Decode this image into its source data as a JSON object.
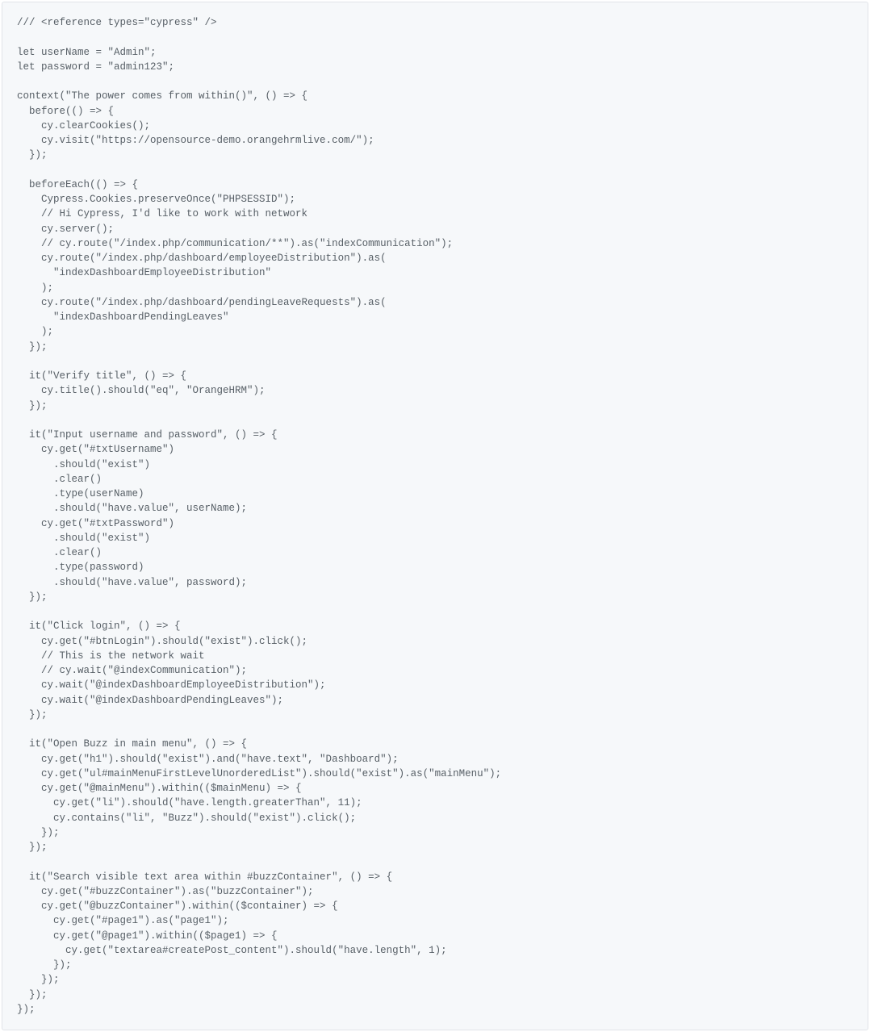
{
  "code": "/// <reference types=\"cypress\" />\n\nlet userName = \"Admin\";\nlet password = \"admin123\";\n\ncontext(\"The power comes from within()\", () => {\n  before(() => {\n    cy.clearCookies();\n    cy.visit(\"https://opensource-demo.orangehrmlive.com/\");\n  });\n\n  beforeEach(() => {\n    Cypress.Cookies.preserveOnce(\"PHPSESSID\");\n    // Hi Cypress, I'd like to work with network\n    cy.server();\n    // cy.route(\"/index.php/communication/**\").as(\"indexCommunication\");\n    cy.route(\"/index.php/dashboard/employeeDistribution\").as(\n      \"indexDashboardEmployeeDistribution\"\n    );\n    cy.route(\"/index.php/dashboard/pendingLeaveRequests\").as(\n      \"indexDashboardPendingLeaves\"\n    );\n  });\n\n  it(\"Verify title\", () => {\n    cy.title().should(\"eq\", \"OrangeHRM\");\n  });\n\n  it(\"Input username and password\", () => {\n    cy.get(\"#txtUsername\")\n      .should(\"exist\")\n      .clear()\n      .type(userName)\n      .should(\"have.value\", userName);\n    cy.get(\"#txtPassword\")\n      .should(\"exist\")\n      .clear()\n      .type(password)\n      .should(\"have.value\", password);\n  });\n\n  it(\"Click login\", () => {\n    cy.get(\"#btnLogin\").should(\"exist\").click();\n    // This is the network wait\n    // cy.wait(\"@indexCommunication\");\n    cy.wait(\"@indexDashboardEmployeeDistribution\");\n    cy.wait(\"@indexDashboardPendingLeaves\");\n  });\n\n  it(\"Open Buzz in main menu\", () => {\n    cy.get(\"h1\").should(\"exist\").and(\"have.text\", \"Dashboard\");\n    cy.get(\"ul#mainMenuFirstLevelUnorderedList\").should(\"exist\").as(\"mainMenu\");\n    cy.get(\"@mainMenu\").within(($mainMenu) => {\n      cy.get(\"li\").should(\"have.length.greaterThan\", 11);\n      cy.contains(\"li\", \"Buzz\").should(\"exist\").click();\n    });\n  });\n\n  it(\"Search visible text area within #buzzContainer\", () => {\n    cy.get(\"#buzzContainer\").as(\"buzzContainer\");\n    cy.get(\"@buzzContainer\").within(($container) => {\n      cy.get(\"#page1\").as(\"page1\");\n      cy.get(\"@page1\").within(($page1) => {\n        cy.get(\"textarea#createPost_content\").should(\"have.length\", 1);\n      });\n    });\n  });\n});"
}
